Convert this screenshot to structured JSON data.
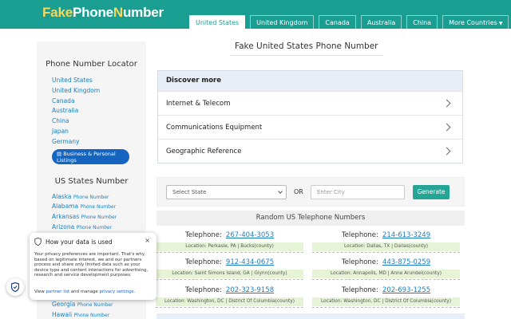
{
  "header": {
    "logo_part1": "Fake",
    "logo_part2": "Phone",
    "logo_part3": "N",
    "logo_part4": "umber",
    "tabs": [
      {
        "label": "United States",
        "active": true
      },
      {
        "label": "United Kingdom"
      },
      {
        "label": "Canada"
      },
      {
        "label": "Australia"
      },
      {
        "label": "China"
      },
      {
        "label": "More Countries"
      }
    ]
  },
  "sidebar": {
    "title": "Phone Number Locator",
    "countries": [
      "United States",
      "United Kingdom",
      "Canada",
      "Australia",
      "China",
      "Japan",
      "Germany"
    ],
    "pill_line1": "Business & Personal",
    "pill_line2": "Listings",
    "states_title": "US States Number",
    "states": [
      {
        "name": "Alaska",
        "suffix": "Phone Number"
      },
      {
        "name": "Alabama",
        "suffix": "Phone Number"
      },
      {
        "name": "Arkansas",
        "suffix": "Phone Number"
      },
      {
        "name": "Arizona",
        "suffix": "Phone Number"
      }
    ],
    "states_bottom": [
      {
        "name": "Georgia",
        "suffix": "Phone Number"
      },
      {
        "name": "Hawaii",
        "suffix": "Phone Number"
      }
    ]
  },
  "main": {
    "title": "Fake United States Phone Number",
    "discover": {
      "heading": "Discover more",
      "items": [
        "Internet & Telecom",
        "Communications Equipment",
        "Geographic Reference"
      ]
    },
    "filter": {
      "select_label": "Select State",
      "or": "OR",
      "city_placeholder": "Enter City",
      "generate": "Generate"
    },
    "random_heading": "Random US Telephone Numbers",
    "phone_label": "Telephone:",
    "phones": [
      {
        "number": "267-404-3053",
        "location": "Location: Perkasie, PA | Bucks(county)"
      },
      {
        "number": "214-613-3249",
        "location": "Location: Dallas, TX | Dallas(county)"
      },
      {
        "number": "912-434-0675",
        "location": "Location: Saint Simons Island, GA | Glynn(county)"
      },
      {
        "number": "443-875-0259",
        "location": "Location: Annapolis, MD | Anne Arundel(county)"
      },
      {
        "number": "202-323-9158",
        "location": "Location: Washington, DC | District Of Columbia(county)"
      },
      {
        "number": "202-693-1255",
        "location": "Location: Washington, DC | District Of Columbia(county)"
      }
    ]
  },
  "privacy": {
    "title": "How your data is used",
    "close": "×",
    "body": "Your privacy preferences are important. That's why, based on legitimate interest, we and our partners process and share only limited data such as your device type and content interactions for advertising, research and service development purposes.",
    "foot_prefix": "View ",
    "foot_link1": "partner list",
    "foot_mid": " and manage ",
    "foot_link2": "privacy settings",
    "foot_end": "."
  }
}
